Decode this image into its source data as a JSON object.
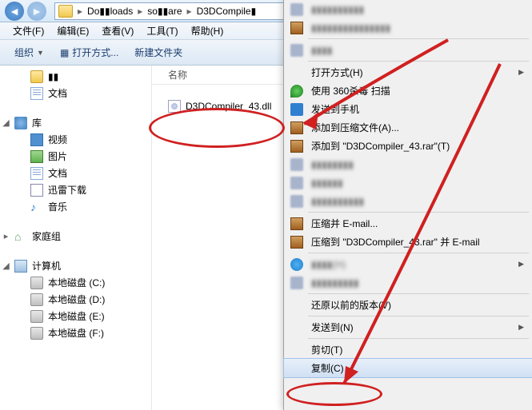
{
  "breadcrumbs": [
    "Do▮▮loads",
    "so▮▮are",
    "D3DCompile▮"
  ],
  "menubar": [
    "文件(F)",
    "编辑(E)",
    "查看(V)",
    "工具(T)",
    "帮助(H)"
  ],
  "toolbar": {
    "organize": "组织",
    "openWith": "打开方式...",
    "newFolder": "新建文件夹"
  },
  "sidebar": {
    "downloads": "▮▮",
    "docs1": "文档",
    "lib": "库",
    "video": "视频",
    "pics": "图片",
    "docs2": "文档",
    "thunder": "迅雷下载",
    "music": "音乐",
    "homegroup": "家庭组",
    "computer": "计算机",
    "drives": [
      "本地磁盘 (C:)",
      "本地磁盘 (D:)",
      "本地磁盘 (E:)",
      "本地磁盘 (F:)"
    ]
  },
  "content": {
    "colName": "名称",
    "file": "D3DCompiler_43.dll"
  },
  "ctx": {
    "openWith": "打开方式(H)",
    "scan": "使用 360杀毒 扫描",
    "sendPhone": "发送到手机",
    "addArchive": "添加到压缩文件(A)...",
    "addRar": "添加到 \"D3DCompiler_43.rar\"(T)",
    "emailZip": "压缩并 E-mail...",
    "emailRar": "压缩到 \"D3DCompiler_43.rar\" 并 E-mail",
    "restore": "还原以前的版本(V)",
    "sendTo": "发送到(N)",
    "cut": "剪切(T)",
    "copy": "复制(C)"
  }
}
